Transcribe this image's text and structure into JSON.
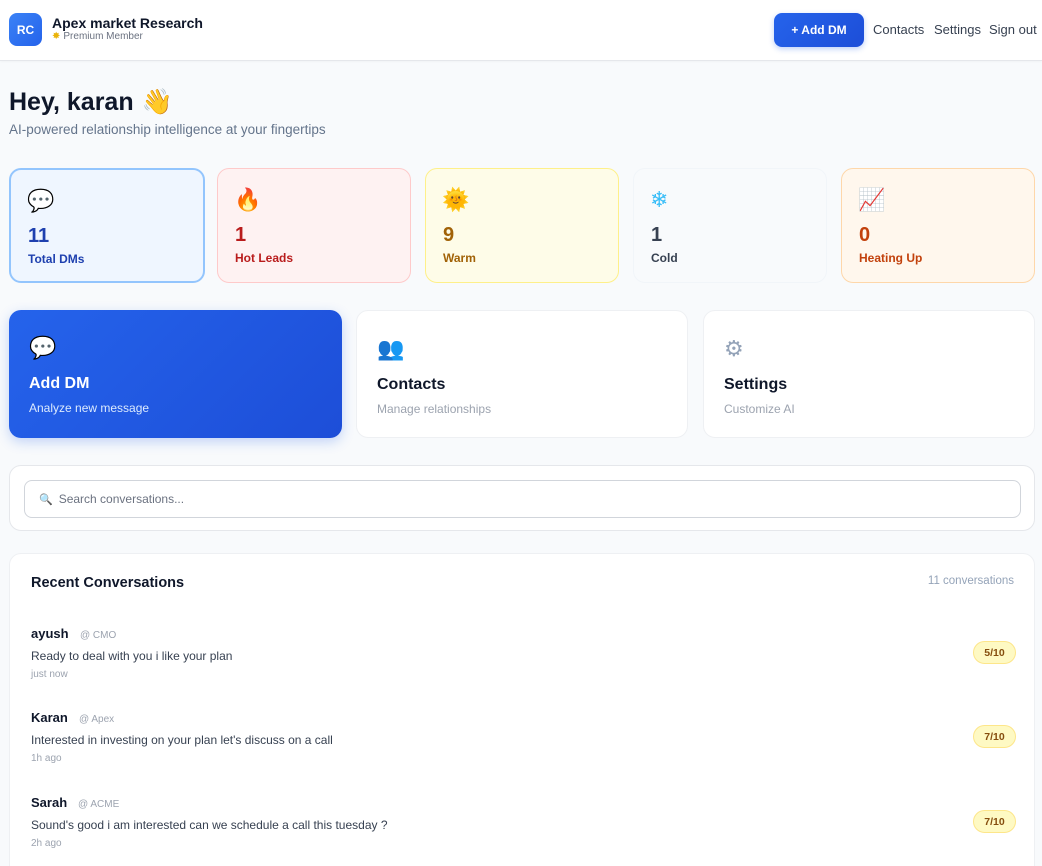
{
  "header": {
    "logo_initials": "RC",
    "brand_name": "Apex market Research",
    "member_badge": "Premium Member",
    "add_dm_label": "+ Add DM",
    "nav": {
      "contacts": "Contacts",
      "settings": "Settings",
      "sign_out": "Sign out"
    }
  },
  "greeting": {
    "title": "Hey, karan",
    "emoji": "👋",
    "subtitle": "AI-powered relationship intelligence at your fingertips"
  },
  "stats": [
    {
      "icon": "💬",
      "icon_name": "speech-bubble-icon",
      "value": "11",
      "label": "Total DMs",
      "color": "#1e40af"
    },
    {
      "icon": "🔥",
      "icon_name": "fire-icon",
      "value": "1",
      "label": "Hot Leads",
      "color": "#b91c1c"
    },
    {
      "icon": "🌞",
      "icon_name": "sun-icon",
      "value": "9",
      "label": "Warm",
      "color": "#a16207"
    },
    {
      "icon": "❄",
      "icon_name": "snowflake-icon",
      "value": "1",
      "label": "Cold",
      "color": "#374151"
    },
    {
      "icon": "📈",
      "icon_name": "chart-up-icon",
      "value": "0",
      "label": "Heating Up",
      "color": "#c2410c"
    }
  ],
  "actions": [
    {
      "icon": "💬",
      "icon_name": "speech-bubble-icon",
      "title": "Add DM",
      "subtitle": "Analyze new message"
    },
    {
      "icon": "👥",
      "icon_name": "people-icon",
      "title": "Contacts",
      "subtitle": "Manage relationships"
    },
    {
      "icon": "⚙",
      "icon_name": "gear-icon",
      "title": "Settings",
      "subtitle": "Customize AI"
    }
  ],
  "search": {
    "placeholder": "Search conversations..."
  },
  "recent": {
    "title": "Recent Conversations",
    "count_label": "11 conversations",
    "items": [
      {
        "name": "ayush",
        "company": "@ CMO",
        "message": "Ready to deal with you i like your plan",
        "time": "just now",
        "score": "5/10"
      },
      {
        "name": "Karan",
        "company": "@ Apex",
        "message": "Interested in investing on your plan let's discuss on a call",
        "time": "1h ago",
        "score": "7/10"
      },
      {
        "name": "Sarah",
        "company": "@ ACME",
        "message": "Sound's good i am interested can we schedule a call this tuesday ?",
        "time": "2h ago",
        "score": "7/10"
      }
    ]
  },
  "colors": {
    "accent": "#2563eb",
    "background": "#f8fafc",
    "score_badge": "#fef9c3"
  }
}
